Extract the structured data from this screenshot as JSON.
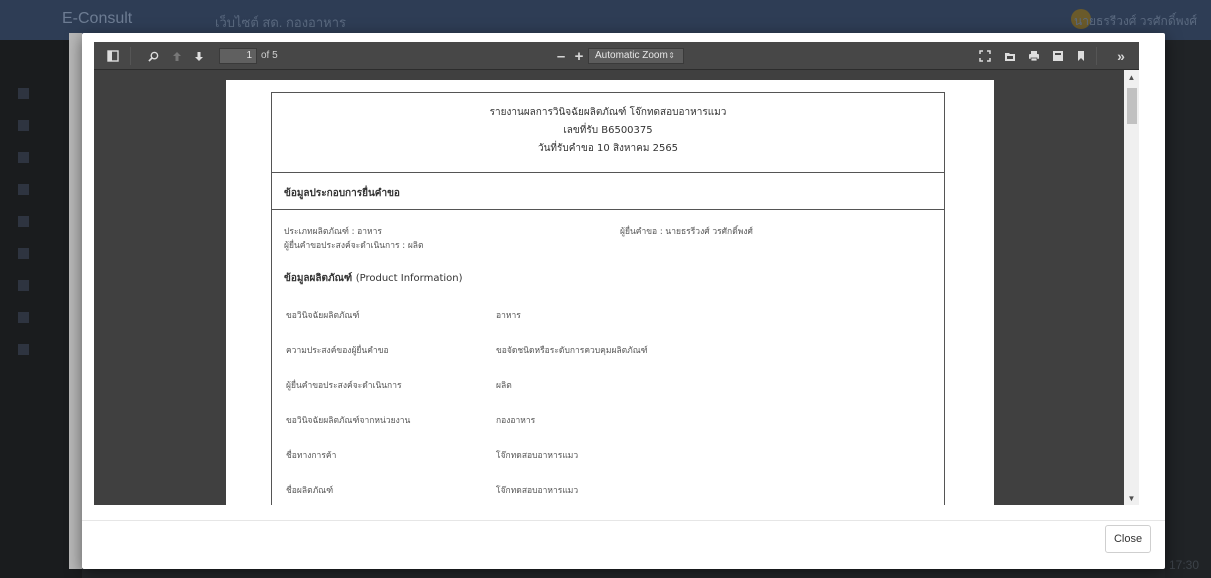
{
  "background": {
    "brand": "E-Consult",
    "header_title": "เว็บไซต์ สด. กองอาหาร",
    "header_user": "นายธรรีวงศ์ วรศักดิ์พงศ์",
    "time": "17:30"
  },
  "pdf_toolbar": {
    "page_current": "1",
    "page_total_label": "of 5",
    "zoom_label": "Automatic Zoom",
    "icons": [
      "sidebar-toggle-icon",
      "search-icon",
      "previous-page-icon",
      "next-page-icon",
      "zoom-out-icon",
      "zoom-in-icon",
      "presentation-mode-icon",
      "open-file-icon",
      "print-icon",
      "download-icon",
      "bookmark-icon",
      "tools-icon"
    ]
  },
  "document": {
    "title_line1": "รายงานผลการวินิจฉัยผลิตภัณฑ์ โจ๊กทดสอบอาหารแมว",
    "title_line2": "เลขที่รับ B6500375",
    "title_line3": "วันที่รับคำขอ 10 สิงหาคม 2565",
    "section_applicant": "ข้อมูลประกอบการยื่นคำขอ",
    "product_type": "ประเภทผลิตภัณฑ์ : อาหาร",
    "applicant_intent": "ผู้ยื่นคำขอประสงค์จะดำเนินการ : ผลิต",
    "applicant_name": "ผู้ยื่นคำขอ : นายธรรีวงศ์ วรศักดิ์พงศ์",
    "product_info_title": "ข้อมูลผลิตภัณฑ์",
    "product_info_en": "(Product Information)",
    "rows": [
      {
        "label": "ขอวินิจฉัยผลิตภัณฑ์",
        "value": "อาหาร"
      },
      {
        "label": "ความประสงค์ของผู้ยื่นคำขอ",
        "value": "ขอจัดชนิดหรือระดับการควบคุมผลิตภัณฑ์"
      },
      {
        "label": "ผู้ยื่นคำขอประสงค์จะดำเนินการ",
        "value": "ผลิต"
      },
      {
        "label": "ขอวินิจฉัยผลิตภัณฑ์จากหน่วยงาน",
        "value": "กองอาหาร"
      },
      {
        "label": "ชื่อทางการค้า",
        "value": "โจ๊กทดสอบอาหารแมว"
      },
      {
        "label": "ชื่อผลิตภัณฑ์",
        "value": "โจ๊กทดสอบอาหารแมว"
      }
    ]
  },
  "footer": {
    "close_label": "Close"
  }
}
